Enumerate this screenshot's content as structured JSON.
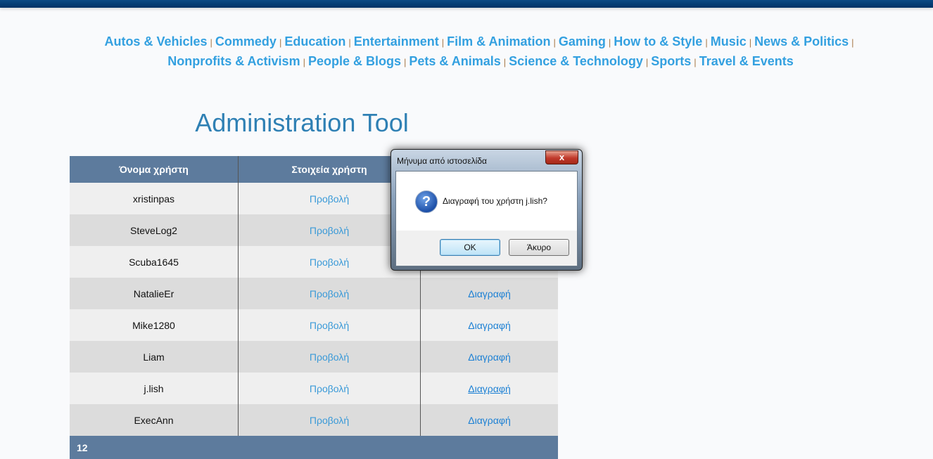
{
  "nav": {
    "categories": [
      "Autos & Vehicles",
      "Commedy",
      "Education",
      "Entertainment",
      "Film & Animation",
      "Gaming",
      "How to & Style",
      "Music",
      "News & Politics",
      "Nonprofits & Activism",
      "People & Blogs",
      "Pets & Animals",
      "Science & Technology",
      "Sports",
      "Travel & Events"
    ],
    "separator": "|"
  },
  "page_title": "Administration Tool",
  "table": {
    "headers": [
      "Όνομα χρήστη",
      "Στοιχεία χρήστη",
      ""
    ],
    "rows": [
      {
        "username": "xristinpas",
        "details": "Προβολή",
        "delete": ""
      },
      {
        "username": "SteveLog2",
        "details": "Προβολή",
        "delete": ""
      },
      {
        "username": "Scuba1645",
        "details": "Προβολή",
        "delete": ""
      },
      {
        "username": "NatalieEr",
        "details": "Προβολή",
        "delete": "Διαγραφή"
      },
      {
        "username": "Mike1280",
        "details": "Προβολή",
        "delete": "Διαγραφή"
      },
      {
        "username": "Liam",
        "details": "Προβολή",
        "delete": "Διαγραφή"
      },
      {
        "username": "j.lish",
        "details": "Προβολή",
        "delete": "Διαγραφή"
      },
      {
        "username": "ExecAnn",
        "details": "Προβολή",
        "delete": "Διαγραφή"
      }
    ],
    "footer": "12"
  },
  "dialog": {
    "title": "Μήνυμα από ιστοσελίδα",
    "close": "x",
    "icon": "question-icon",
    "message": "Διαγραφή του χρήστη j.lish?",
    "ok": "OK",
    "cancel": "Άκυρο"
  },
  "colors": {
    "header_bg": "#5d7b9d",
    "link": "#33a0e0",
    "title": "#2f80b4"
  }
}
